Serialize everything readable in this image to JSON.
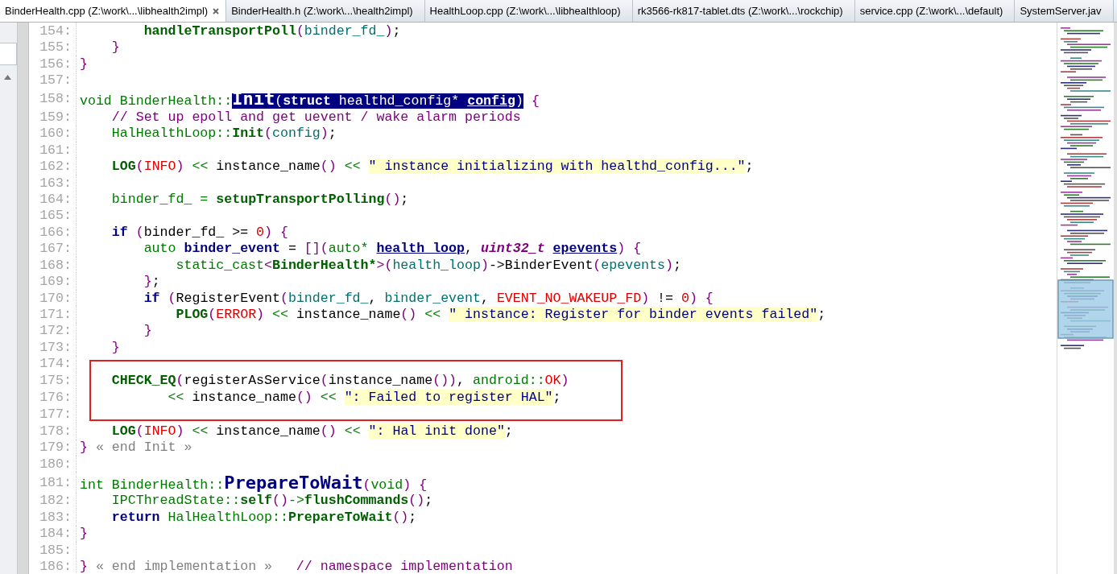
{
  "tabs": [
    {
      "label": "BinderHealth.cpp (Z:\\work\\...\\libhealth2impl)",
      "selected": true
    },
    {
      "label": "BinderHealth.h (Z:\\work\\...\\health2impl)",
      "selected": false
    },
    {
      "label": "HealthLoop.cpp (Z:\\work\\...\\libhealthloop)",
      "selected": false
    },
    {
      "label": "rk3566-rk817-tablet.dts (Z:\\work\\...\\rockchip)",
      "selected": false
    },
    {
      "label": "service.cpp (Z:\\work\\...\\default)",
      "selected": false
    },
    {
      "label": "SystemServer.jav",
      "selected": false
    }
  ],
  "editor": {
    "lines": [
      {
        "number": "154:",
        "tokens": [
          {
            "text": "        handleTransportPoll",
            "kind": "func"
          },
          {
            "text": "(",
            "kind": "punct"
          },
          {
            "text": "binder_fd_",
            "kind": "var"
          },
          {
            "text": ")",
            "kind": "punct"
          },
          {
            "text": ";",
            "kind": "plain"
          }
        ]
      },
      {
        "number": "155:",
        "tokens": [
          {
            "text": "    }",
            "kind": "punct"
          }
        ]
      },
      {
        "number": "156:",
        "tokens": [
          {
            "text": "}",
            "kind": "punct"
          }
        ]
      },
      {
        "number": "157:"
      },
      {
        "number": "158:",
        "tokens": [
          {
            "text": "void BinderHealth::",
            "kind": "type"
          },
          {
            "kind": "selection",
            "parts": [
              {
                "text": "Init",
                "kind": "title"
              },
              {
                "text": "(",
                "kind": "punct"
              },
              {
                "text": "struct",
                "kind": "keyword"
              },
              {
                "text": " healthd_config* ",
                "kind": "plain"
              },
              {
                "text": "config",
                "kind": "param"
              },
              {
                "text": ")",
                "kind": "punct"
              }
            ]
          },
          {
            "text": " {",
            "kind": "punct"
          }
        ]
      },
      {
        "number": "159:",
        "tokens": [
          {
            "text": "    // Set up epoll and get uevent / wake alarm periods",
            "kind": "comment"
          }
        ]
      },
      {
        "number": "160:",
        "tokens": [
          {
            "text": "    HalHealthLoop::",
            "kind": "type"
          },
          {
            "text": "Init",
            "kind": "func"
          },
          {
            "text": "(",
            "kind": "punct"
          },
          {
            "text": "config",
            "kind": "var"
          },
          {
            "text": ")",
            "kind": "punct"
          },
          {
            "text": ";",
            "kind": "plain"
          }
        ]
      },
      {
        "number": "161:"
      },
      {
        "number": "162:",
        "tokens": [
          {
            "text": "    LOG",
            "kind": "func"
          },
          {
            "text": "(",
            "kind": "punct"
          },
          {
            "text": "INFO",
            "kind": "const"
          },
          {
            "text": ")",
            "kind": "punct"
          },
          {
            "text": " << ",
            "kind": "op"
          },
          {
            "text": "instance_name",
            "kind": "plain"
          },
          {
            "text": "()",
            "kind": "punct"
          },
          {
            "text": " << ",
            "kind": "op"
          },
          {
            "text": "\" instance initializing with healthd_config...\"",
            "kind": "string"
          },
          {
            "text": ";",
            "kind": "plain"
          }
        ]
      },
      {
        "number": "163:"
      },
      {
        "number": "164:",
        "tokens": [
          {
            "text": "    binder_fd_ = ",
            "kind": "type"
          },
          {
            "text": "setupTransportPolling",
            "kind": "func"
          },
          {
            "text": "()",
            "kind": "punct"
          },
          {
            "text": ";",
            "kind": "plain"
          }
        ]
      },
      {
        "number": "165:"
      },
      {
        "number": "166:",
        "tokens": [
          {
            "text": "    if",
            "kind": "keyword"
          },
          {
            "text": " (",
            "kind": "punct"
          },
          {
            "text": "binder_fd_ >= ",
            "kind": "plain"
          },
          {
            "text": "0",
            "kind": "const"
          },
          {
            "text": ") {",
            "kind": "punct"
          }
        ]
      },
      {
        "number": "167:",
        "tokens": [
          {
            "text": "        auto ",
            "kind": "type"
          },
          {
            "text": "binder_event",
            "kind": "decl"
          },
          {
            "text": " = ",
            "kind": "plain"
          },
          {
            "text": "[](",
            "kind": "punct"
          },
          {
            "text": "auto* ",
            "kind": "type"
          },
          {
            "text": "health_loop",
            "kind": "param"
          },
          {
            "text": ", ",
            "kind": "plain"
          },
          {
            "text": "uint32_t ",
            "kind": "typeq"
          },
          {
            "text": "epevents",
            "kind": "param"
          },
          {
            "text": ") {",
            "kind": "punct"
          }
        ]
      },
      {
        "number": "168:",
        "tokens": [
          {
            "text": "            static_cast",
            "kind": "type"
          },
          {
            "text": "<",
            "kind": "punct"
          },
          {
            "text": "BinderHealth*",
            "kind": "func"
          },
          {
            "text": ">(",
            "kind": "punct"
          },
          {
            "text": "health_loop",
            "kind": "var"
          },
          {
            "text": ")",
            "kind": "punct"
          },
          {
            "text": "->BinderEvent",
            "kind": "plain"
          },
          {
            "text": "(",
            "kind": "punct"
          },
          {
            "text": "epevents",
            "kind": "var"
          },
          {
            "text": ")",
            "kind": "punct"
          },
          {
            "text": ";",
            "kind": "plain"
          }
        ]
      },
      {
        "number": "169:",
        "tokens": [
          {
            "text": "        }",
            "kind": "punct"
          },
          {
            "text": ";",
            "kind": "plain"
          }
        ]
      },
      {
        "number": "170:",
        "tokens": [
          {
            "text": "        if",
            "kind": "keyword"
          },
          {
            "text": " (",
            "kind": "punct"
          },
          {
            "text": "RegisterEvent",
            "kind": "plain"
          },
          {
            "text": "(",
            "kind": "punct"
          },
          {
            "text": "binder_fd_",
            "kind": "var"
          },
          {
            "text": ", ",
            "kind": "plain"
          },
          {
            "text": "binder_event",
            "kind": "var"
          },
          {
            "text": ", ",
            "kind": "plain"
          },
          {
            "text": "EVENT_NO_WAKEUP_FD",
            "kind": "const"
          },
          {
            "text": ")",
            "kind": "punct"
          },
          {
            "text": " != ",
            "kind": "plain"
          },
          {
            "text": "0",
            "kind": "const"
          },
          {
            "text": ") {",
            "kind": "punct"
          }
        ]
      },
      {
        "number": "171:",
        "tokens": [
          {
            "text": "            PLOG",
            "kind": "func"
          },
          {
            "text": "(",
            "kind": "punct"
          },
          {
            "text": "ERROR",
            "kind": "const"
          },
          {
            "text": ")",
            "kind": "punct"
          },
          {
            "text": " << ",
            "kind": "op"
          },
          {
            "text": "instance_name",
            "kind": "plain"
          },
          {
            "text": "()",
            "kind": "punct"
          },
          {
            "text": " << ",
            "kind": "op"
          },
          {
            "text": "\" instance: Register for binder events failed\"",
            "kind": "string"
          },
          {
            "text": ";",
            "kind": "plain"
          }
        ]
      },
      {
        "number": "172:",
        "tokens": [
          {
            "text": "        }",
            "kind": "punct"
          }
        ]
      },
      {
        "number": "173:",
        "tokens": [
          {
            "text": "    }",
            "kind": "punct"
          }
        ]
      },
      {
        "number": "174:"
      },
      {
        "number": "175:",
        "boxed": true,
        "tokens": [
          {
            "text": "    CHECK_EQ",
            "kind": "func"
          },
          {
            "text": "(",
            "kind": "punct"
          },
          {
            "text": "registerAsService",
            "kind": "plain"
          },
          {
            "text": "(",
            "kind": "punct"
          },
          {
            "text": "instance_name",
            "kind": "plain"
          },
          {
            "text": "())",
            "kind": "punct"
          },
          {
            "text": ", ",
            "kind": "plain"
          },
          {
            "text": "android::",
            "kind": "type"
          },
          {
            "text": "OK",
            "kind": "const"
          },
          {
            "text": ")",
            "kind": "punct"
          }
        ]
      },
      {
        "number": "176:",
        "boxed": true,
        "tokens": [
          {
            "text": "           << ",
            "kind": "op"
          },
          {
            "text": "instance_name",
            "kind": "plain"
          },
          {
            "text": "()",
            "kind": "punct"
          },
          {
            "text": " << ",
            "kind": "op"
          },
          {
            "text": "\": Failed to register HAL\"",
            "kind": "string"
          },
          {
            "text": ";",
            "kind": "plain"
          }
        ]
      },
      {
        "number": "177:",
        "boxed": true
      },
      {
        "number": "178:",
        "tokens": [
          {
            "text": "    LOG",
            "kind": "func"
          },
          {
            "text": "(",
            "kind": "punct"
          },
          {
            "text": "INFO",
            "kind": "const"
          },
          {
            "text": ")",
            "kind": "punct"
          },
          {
            "text": " << ",
            "kind": "op"
          },
          {
            "text": "instance_name",
            "kind": "plain"
          },
          {
            "text": "()",
            "kind": "punct"
          },
          {
            "text": " << ",
            "kind": "op"
          },
          {
            "text": "\": Hal init done\"",
            "kind": "string"
          },
          {
            "text": ";",
            "kind": "plain"
          }
        ]
      },
      {
        "number": "179:",
        "tokens": [
          {
            "text": "}",
            "kind": "punct"
          },
          {
            "text": " « end Init »",
            "kind": "fold"
          }
        ]
      },
      {
        "number": "180:"
      },
      {
        "number": "181:",
        "tokens": [
          {
            "text": "int BinderHealth::",
            "kind": "type"
          },
          {
            "text": "PrepareToWait",
            "kind": "title"
          },
          {
            "text": "(",
            "kind": "punct"
          },
          {
            "text": "void",
            "kind": "type"
          },
          {
            "text": ") {",
            "kind": "punct"
          }
        ]
      },
      {
        "number": "182:",
        "tokens": [
          {
            "text": "    IPCThreadState::",
            "kind": "type"
          },
          {
            "text": "self",
            "kind": "func"
          },
          {
            "text": "()",
            "kind": "punct"
          },
          {
            "text": "->",
            "kind": "type"
          },
          {
            "text": "flushCommands",
            "kind": "func"
          },
          {
            "text": "()",
            "kind": "punct"
          },
          {
            "text": ";",
            "kind": "plain"
          }
        ]
      },
      {
        "number": "183:",
        "tokens": [
          {
            "text": "    return",
            "kind": "keyword"
          },
          {
            "text": " HalHealthLoop::",
            "kind": "type"
          },
          {
            "text": "PrepareToWait",
            "kind": "func"
          },
          {
            "text": "()",
            "kind": "punct"
          },
          {
            "text": ";",
            "kind": "plain"
          }
        ]
      },
      {
        "number": "184:",
        "tokens": [
          {
            "text": "}",
            "kind": "punct"
          }
        ]
      },
      {
        "number": "185:"
      },
      {
        "number": "186:",
        "tokens": [
          {
            "text": "}",
            "kind": "punct"
          },
          {
            "text": " « end implementation »",
            "kind": "fold"
          },
          {
            "text": "   // namespace implementation",
            "kind": "comment"
          }
        ]
      }
    ]
  }
}
